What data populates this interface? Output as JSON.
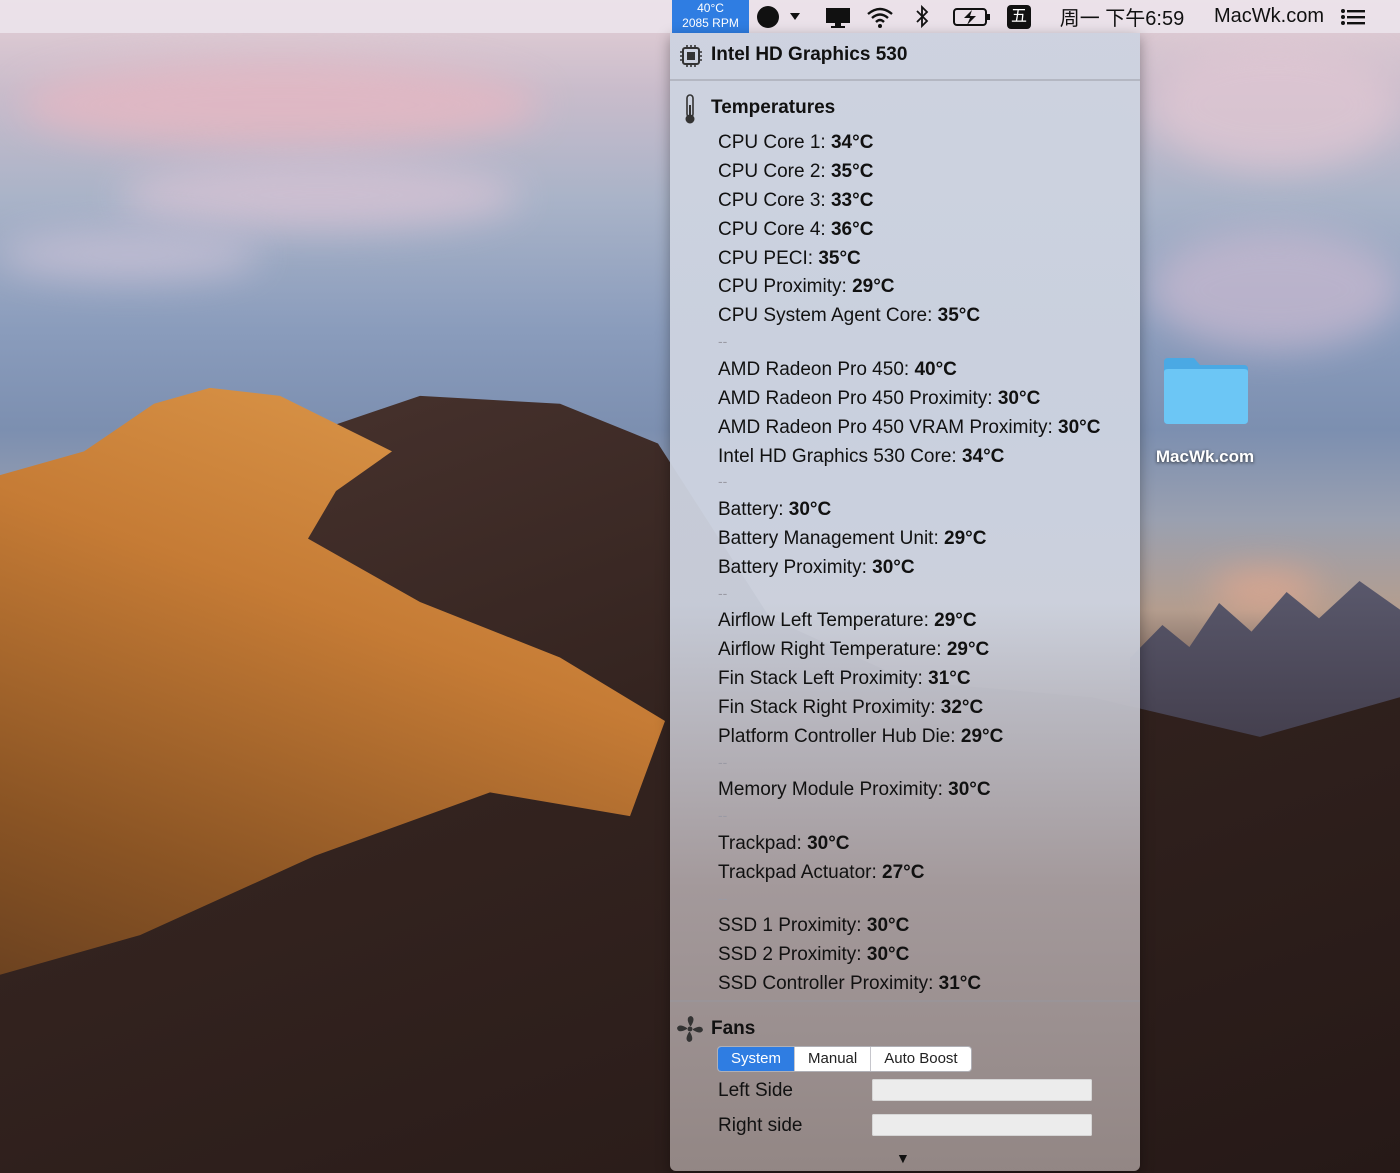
{
  "menubar": {
    "temp_readout": "40°C",
    "rpm_readout": "2085 RPM",
    "ime_label": "五",
    "clock": "周一 下午6:59",
    "site_label": "MacWk.com"
  },
  "panel": {
    "gpu_title": "Intel HD Graphics 530",
    "temperatures_title": "Temperatures",
    "groups": [
      [
        {
          "label": "CPU Core 1:",
          "value": "34°C"
        },
        {
          "label": "CPU Core 2:",
          "value": "35°C"
        },
        {
          "label": "CPU Core 3:",
          "value": "33°C"
        },
        {
          "label": "CPU Core 4:",
          "value": "36°C"
        },
        {
          "label": "CPU PECI:",
          "value": "35°C"
        },
        {
          "label": "CPU Proximity:",
          "value": "29°C"
        },
        {
          "label": "CPU System Agent Core:",
          "value": "35°C"
        }
      ],
      [
        {
          "label": "AMD Radeon Pro 450:",
          "value": "40°C"
        },
        {
          "label": "AMD Radeon Pro 450 Proximity:",
          "value": "30°C"
        },
        {
          "label": "AMD Radeon Pro 450 VRAM Proximity:",
          "value": "30°C"
        },
        {
          "label": "Intel HD Graphics 530 Core:",
          "value": "34°C"
        }
      ],
      [
        {
          "label": "Battery:",
          "value": "30°C"
        },
        {
          "label": "Battery Management Unit:",
          "value": "29°C"
        },
        {
          "label": "Battery Proximity:",
          "value": "30°C"
        }
      ],
      [
        {
          "label": "Airflow Left Temperature:",
          "value": "29°C"
        },
        {
          "label": "Airflow Right Temperature:",
          "value": "29°C"
        },
        {
          "label": "Fin Stack Left Proximity:",
          "value": "31°C"
        },
        {
          "label": "Fin Stack Right Proximity:",
          "value": "32°C"
        },
        {
          "label": "Platform Controller Hub Die:",
          "value": "29°C"
        }
      ],
      [
        {
          "label": "Memory Module Proximity:",
          "value": "30°C"
        }
      ],
      [
        {
          "label": "Trackpad:",
          "value": "30°C"
        },
        {
          "label": "Trackpad Actuator:",
          "value": "27°C"
        }
      ],
      [
        {
          "label": "SSD 1 Proximity:",
          "value": "30°C"
        },
        {
          "label": "SSD 2 Proximity:",
          "value": "30°C"
        },
        {
          "label": "SSD Controller Proximity:",
          "value": "31°C"
        }
      ]
    ],
    "group_separator": "--",
    "fans_title": "Fans",
    "fan_modes": [
      "System",
      "Manual",
      "Auto Boost"
    ],
    "fan_mode_selected": "System",
    "left_side_label": "Left Side",
    "right_side_label": "Right side"
  },
  "desktop": {
    "folder_label": "MacWk.com"
  },
  "colors": {
    "accent": "#2f7de2",
    "folder": "#5bbef2"
  }
}
